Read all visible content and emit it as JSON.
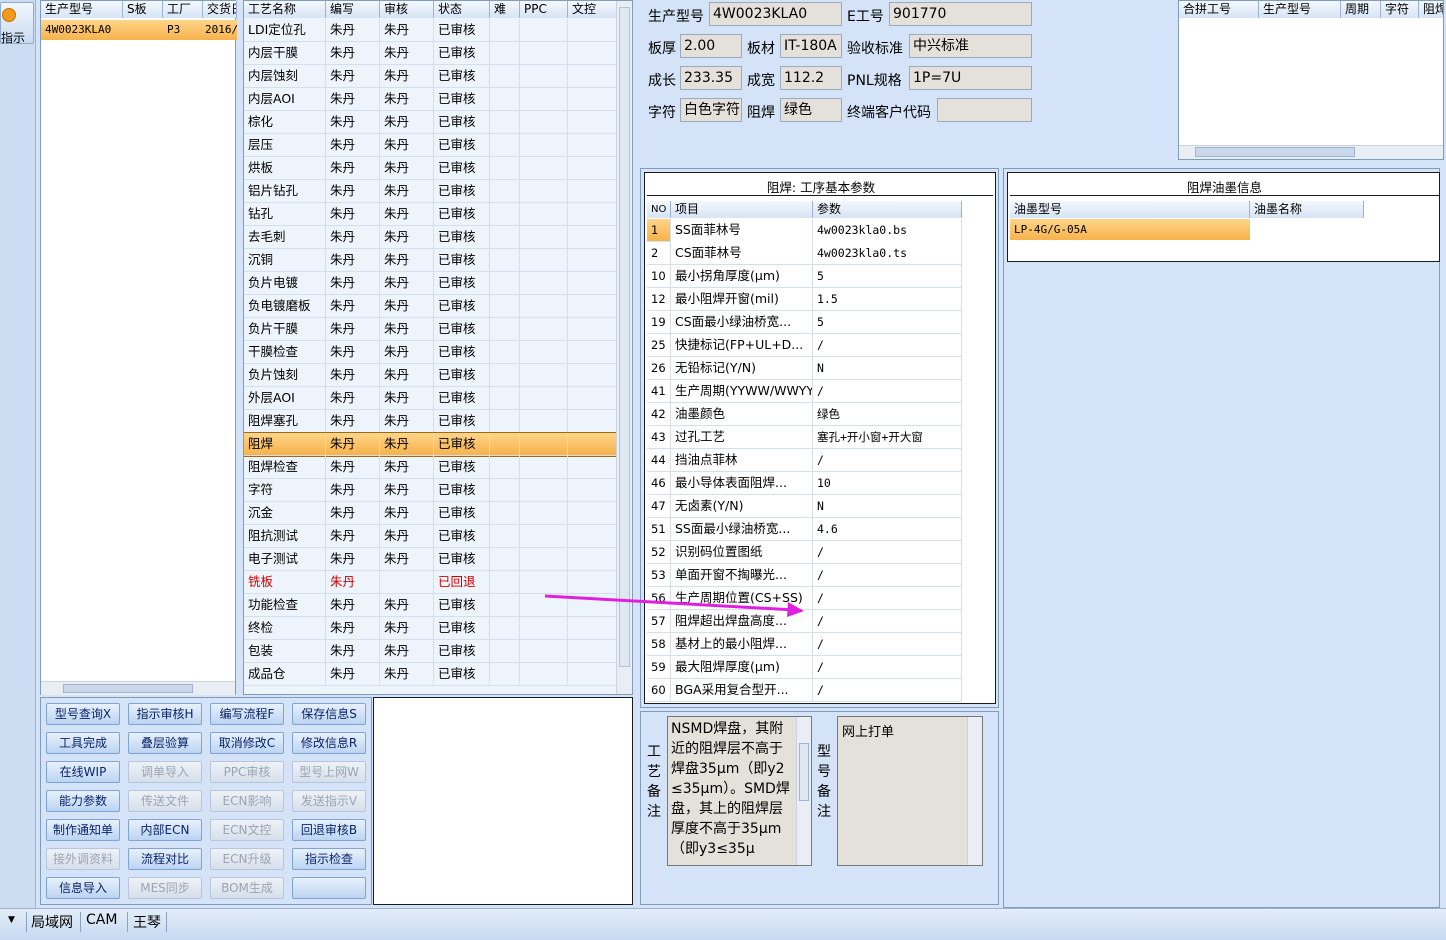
{
  "sidebar": {
    "button_label": "指示"
  },
  "order_grid": {
    "headers": [
      "生产型号",
      "S板",
      "工厂",
      "交货日"
    ],
    "rows": [
      [
        "4W0023KLA0",
        "",
        "P3",
        "2016/"
      ]
    ]
  },
  "process_grid": {
    "headers": [
      "工艺名称",
      "编写",
      "审核",
      "状态",
      "难",
      "PPC",
      "文控"
    ],
    "rows": [
      [
        "LDI定位孔",
        "朱丹",
        "朱丹",
        "已审核"
      ],
      [
        "内层干膜",
        "朱丹",
        "朱丹",
        "已审核"
      ],
      [
        "内层蚀刻",
        "朱丹",
        "朱丹",
        "已审核"
      ],
      [
        "内层AOI",
        "朱丹",
        "朱丹",
        "已审核"
      ],
      [
        "棕化",
        "朱丹",
        "朱丹",
        "已审核"
      ],
      [
        "层压",
        "朱丹",
        "朱丹",
        "已审核"
      ],
      [
        "烘板",
        "朱丹",
        "朱丹",
        "已审核"
      ],
      [
        "铝片钻孔",
        "朱丹",
        "朱丹",
        "已审核"
      ],
      [
        "钻孔",
        "朱丹",
        "朱丹",
        "已审核"
      ],
      [
        "去毛刺",
        "朱丹",
        "朱丹",
        "已审核"
      ],
      [
        "沉铜",
        "朱丹",
        "朱丹",
        "已审核"
      ],
      [
        "负片电镀",
        "朱丹",
        "朱丹",
        "已审核"
      ],
      [
        "负电镀磨板",
        "朱丹",
        "朱丹",
        "已审核"
      ],
      [
        "负片干膜",
        "朱丹",
        "朱丹",
        "已审核"
      ],
      [
        "干膜检查",
        "朱丹",
        "朱丹",
        "已审核"
      ],
      [
        "负片蚀刻",
        "朱丹",
        "朱丹",
        "已审核"
      ],
      [
        "外层AOI",
        "朱丹",
        "朱丹",
        "已审核"
      ],
      [
        "阻焊塞孔",
        "朱丹",
        "朱丹",
        "已审核"
      ],
      [
        "阻焊",
        "朱丹",
        "朱丹",
        "已审核"
      ],
      [
        "阻焊检查",
        "朱丹",
        "朱丹",
        "已审核"
      ],
      [
        "字符",
        "朱丹",
        "朱丹",
        "已审核"
      ],
      [
        "沉金",
        "朱丹",
        "朱丹",
        "已审核"
      ],
      [
        "阻抗测试",
        "朱丹",
        "朱丹",
        "已审核"
      ],
      [
        "电子测试",
        "朱丹",
        "朱丹",
        "已审核"
      ],
      [
        "铣板",
        "朱丹",
        "",
        "已回退"
      ],
      [
        "功能检查",
        "朱丹",
        "朱丹",
        "已审核"
      ],
      [
        "终检",
        "朱丹",
        "朱丹",
        "已审核"
      ],
      [
        "包装",
        "朱丹",
        "朱丹",
        "已审核"
      ],
      [
        "成品仓",
        "朱丹",
        "朱丹",
        "已审核"
      ]
    ],
    "selected_index": 18,
    "rejected_index": 24
  },
  "buttons": [
    [
      "型号查询X",
      "指示审核H",
      "编写流程F",
      "保存信息S"
    ],
    [
      "工具完成",
      "叠层验算",
      "取消修改C",
      "修改信息R"
    ],
    [
      "在线WIP",
      "调单导入",
      "PPC审核",
      "型号上网W"
    ],
    [
      "能力参数",
      "传送文件",
      "ECN影响",
      "发送指示V"
    ],
    [
      "制作通知单",
      "内部ECN",
      "ECN文控",
      "回退审核B"
    ],
    [
      "接外调资料",
      "流程对比",
      "ECN升级",
      "指示检查"
    ],
    [
      "信息导入",
      "MES同步",
      "BOM生成",
      ""
    ]
  ],
  "disabled_buttons": [
    "调单导入",
    "PPC审核",
    "型号上网W",
    "传送文件",
    "ECN影响",
    "发送指示V",
    "ECN文控",
    "接外调资料",
    "ECN升级",
    "MES同步",
    "BOM生成"
  ],
  "info": {
    "model_label": "生产型号",
    "model": "4W0023KLA0",
    "eno_label": "E工号",
    "eno": "901770",
    "thickness_label": "板厚",
    "thickness": "2.00",
    "material_label": "板材",
    "material": "IT-180A",
    "standard_label": "验收标准",
    "standard": "中兴标准",
    "length_label": "成长",
    "length": "233.35",
    "width_label": "成宽",
    "width": "112.2",
    "pnl_label": "PNL规格",
    "pnl": "1P=7U",
    "char_label": "字符",
    "char": "白色字符",
    "mask_label": "阻焊",
    "mask": "绿色",
    "customer_label": "终端客户代码",
    "customer": ""
  },
  "merge_grid": {
    "headers": [
      "合拼工号",
      "生产型号",
      "周期",
      "字符",
      "阻焊"
    ]
  },
  "params_panel": {
    "title": "阻焊: 工序基本参数",
    "headers": [
      "NO",
      "项目",
      "参数"
    ],
    "rows": [
      [
        "1",
        "SS面菲林号",
        "4w0023kla0.bs"
      ],
      [
        "2",
        "CS面菲林号",
        "4w0023kla0.ts"
      ],
      [
        "10",
        "最小拐角厚度(μm)",
        "5"
      ],
      [
        "12",
        "最小阻焊开窗(mil)",
        "1.5"
      ],
      [
        "19",
        "CS面最小绿油桥宽...",
        "5"
      ],
      [
        "25",
        "快捷标记(FP+UL+D...",
        "/"
      ],
      [
        "26",
        "无铅标记(Y/N)",
        "N"
      ],
      [
        "41",
        "生产周期(YYWW/WWYY)",
        "/"
      ],
      [
        "42",
        "油墨颜色",
        "绿色"
      ],
      [
        "43",
        "过孔工艺",
        "塞孔+开小窗+开大窗"
      ],
      [
        "44",
        "挡油点菲林",
        "/"
      ],
      [
        "46",
        "最小导体表面阻焊...",
        "10"
      ],
      [
        "47",
        "无卤素(Y/N)",
        "N"
      ],
      [
        "51",
        "SS面最小绿油桥宽...",
        "4.6"
      ],
      [
        "52",
        "识别码位置图纸",
        "/"
      ],
      [
        "53",
        "单面开窗不掏曝光...",
        "/"
      ],
      [
        "56",
        "生产周期位置(CS+SS)",
        "/"
      ],
      [
        "57",
        "阻焊超出焊盘高度...",
        "/"
      ],
      [
        "58",
        "基材上的最小阻焊...",
        "/"
      ],
      [
        "59",
        "最大阻焊厚度(μm)",
        "/"
      ],
      [
        "60",
        "BGA采用复合型开...",
        "/"
      ]
    ]
  },
  "ink_panel": {
    "title": "阻焊油墨信息",
    "headers": [
      "油墨型号",
      "油墨名称"
    ],
    "rows": [
      [
        "LP-4G/G-05A",
        ""
      ]
    ]
  },
  "notes": {
    "process_label": "工艺备注",
    "process_text": "NSMD焊盘，其附近的阻焊层不高于焊盘35μm（即y2≤35μm）。SMD焊盘，其上的阻焊层厚度不高于35μm（即y3≤35μ",
    "model_label": "型号备注",
    "model_text": "网上打单"
  },
  "statusbar": {
    "items": [
      "局域网",
      "CAM",
      "王琴"
    ]
  },
  "colors": {
    "accent": "#f7b24a",
    "rejected": "#d40000",
    "annotation_arrow": "#e020e0"
  }
}
